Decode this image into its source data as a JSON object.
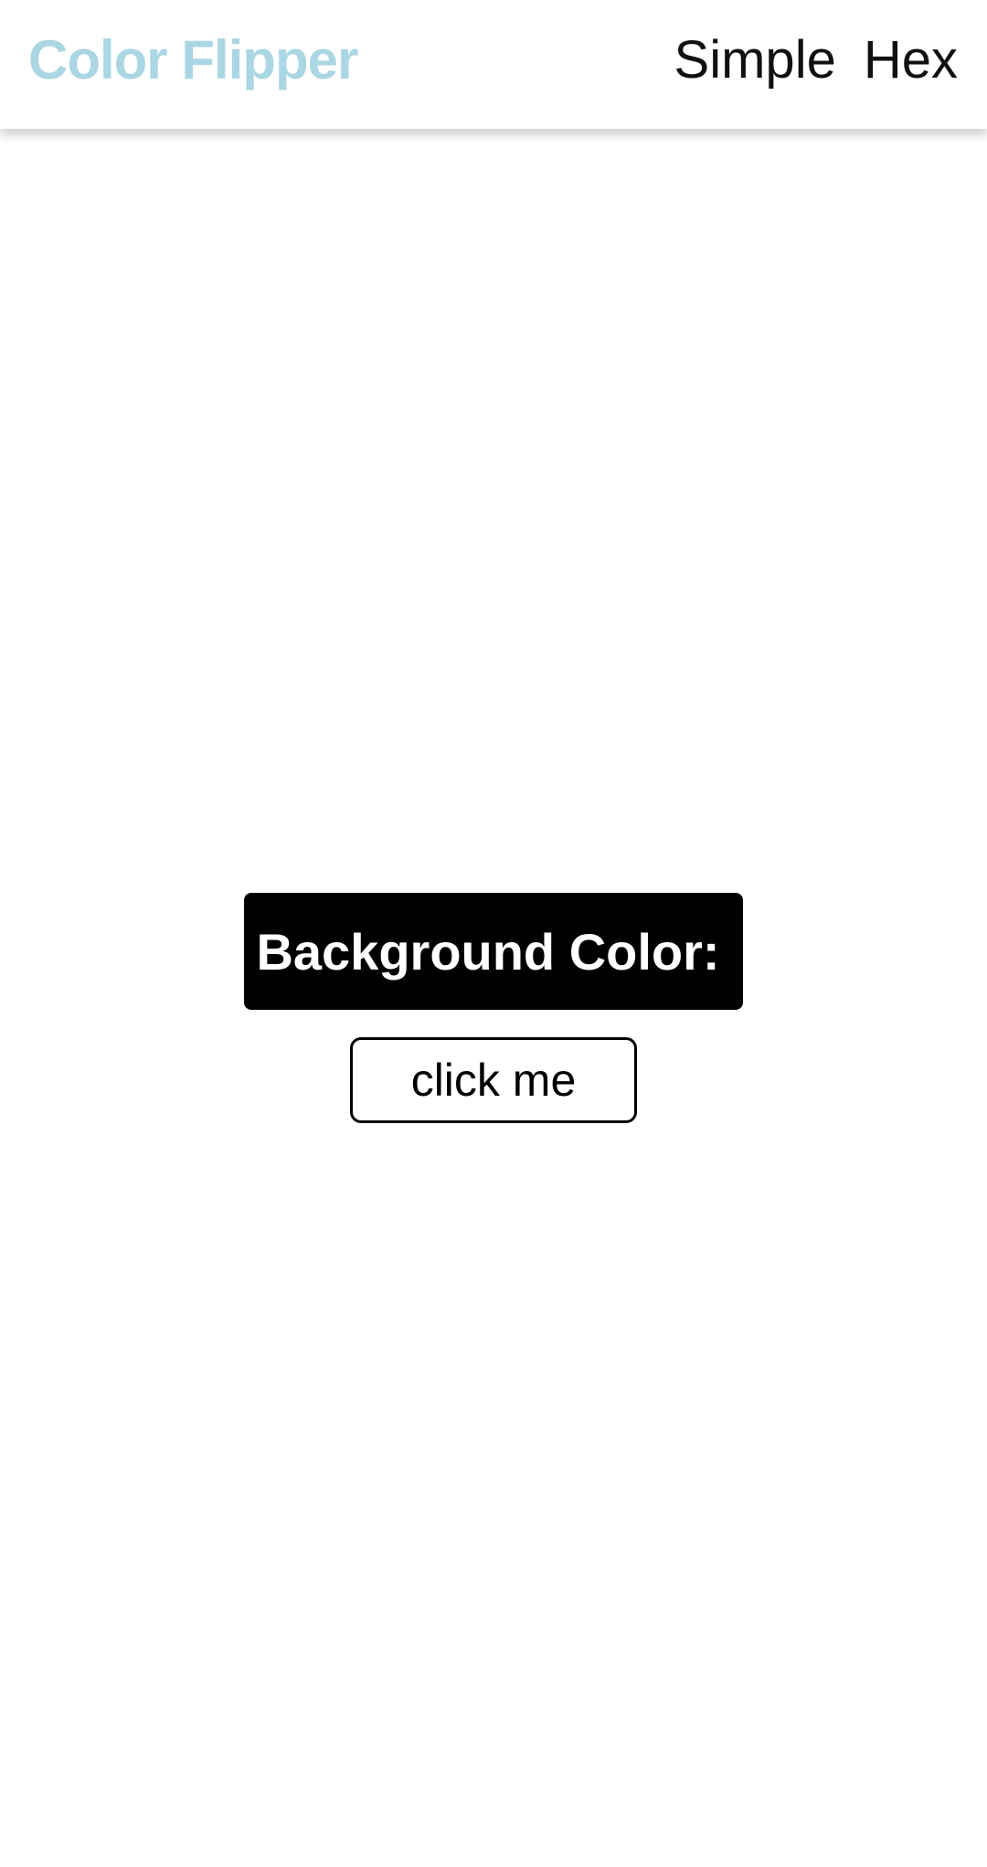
{
  "navbar": {
    "brand": "Color Flipper",
    "links": [
      {
        "label": "Simple"
      },
      {
        "label": "Hex"
      }
    ]
  },
  "main": {
    "banner_label": "Background Color:",
    "banner_value": "",
    "button_label": "click me"
  },
  "colors": {
    "brand": "#abd6e3",
    "background": "#ffffff",
    "banner": "#000000",
    "banner_text": "#ffffff"
  }
}
